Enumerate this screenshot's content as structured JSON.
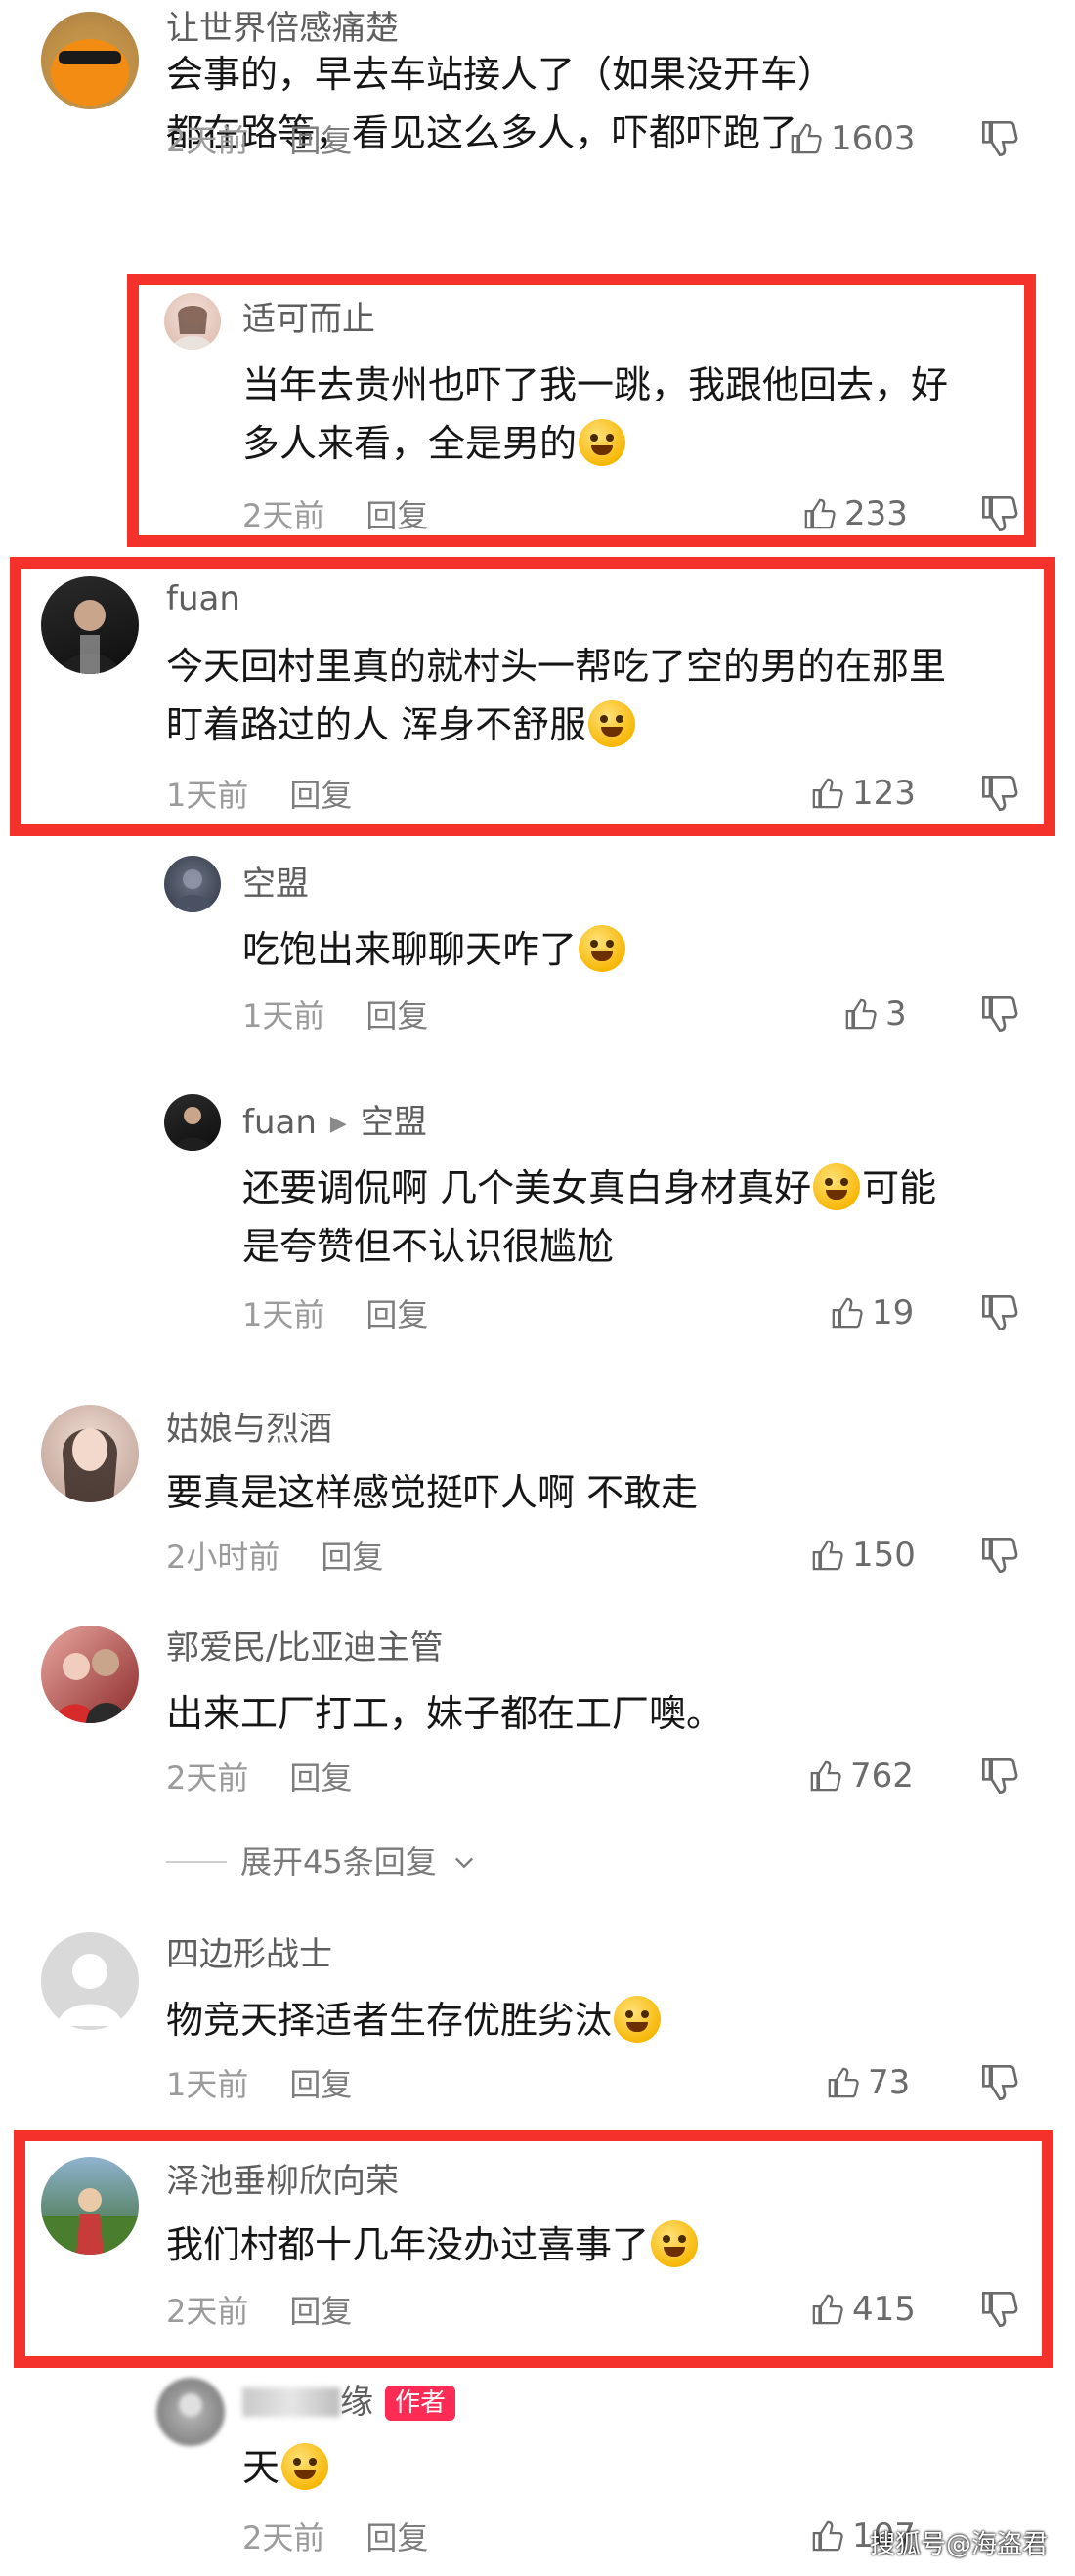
{
  "colors": {
    "highlight": "#f4322b",
    "author_badge": "#fe2c55",
    "meta": "#9b9b9b",
    "name": "#5e5e5e"
  },
  "comments": [
    {
      "user": "让世界倍感痛楚",
      "text": "会事的，早去车站接人了（如果没开车）\n都在路等，看见这么多人，吓都吓跑了",
      "time": "2天前",
      "reply": "回复",
      "likes": "1603",
      "avatar_icon": "orange-sunglasses-avatar"
    },
    {
      "user": "适可而止",
      "text": "当年去贵州也吓了我一跳，我跟他回去，好\n多人来看，全是男的",
      "time": "2天前",
      "reply": "回复",
      "likes": "233",
      "avatar_icon": "girl-avatar"
    },
    {
      "user": "fuan",
      "text": "今天回村里真的就村头一帮吃了空的男的在那里\n盯着路过的人 浑身不舒服",
      "time": "1天前",
      "reply": "回复",
      "likes": "123",
      "avatar_icon": "man-portrait-avatar"
    },
    {
      "user": "空盟",
      "text": "吃饱出来聊聊天咋了",
      "time": "1天前",
      "reply": "回复",
      "likes": "3",
      "avatar_icon": "dark-avatar"
    },
    {
      "user": "fuan",
      "reply_to": "空盟",
      "text": "还要调侃啊 几个美女真白身材真好      可能\n是夸赞但不认识很尴尬",
      "time": "1天前",
      "reply": "回复",
      "likes": "19",
      "avatar_icon": "man-portrait-avatar"
    },
    {
      "user": "姑娘与烈酒",
      "text": "要真是这样感觉挺吓人啊 不敢走",
      "time": "2小时前",
      "reply": "回复",
      "likes": "150",
      "avatar_icon": "woman-avatar"
    },
    {
      "user": "郭爱民/比亚迪主管",
      "text": "出来工厂打工，妹子都在工厂噢。",
      "time": "2天前",
      "reply": "回复",
      "likes": "762",
      "avatar_icon": "couple-avatar"
    },
    {
      "user": "四边形战士",
      "text": "物竞天择适者生存优胜劣汰",
      "time": "1天前",
      "reply": "回复",
      "likes": "73",
      "avatar_icon": "default-user-avatar"
    },
    {
      "user": "泽池垂柳欣向荣",
      "text": "我们村都十几年没办过喜事了",
      "time": "2天前",
      "reply": "回复",
      "likes": "415",
      "avatar_icon": "outdoor-avatar"
    },
    {
      "user": "缘",
      "badge": "作者",
      "text": "天",
      "time": "2天前",
      "reply": "回复",
      "likes": "107",
      "avatar_icon": "blurred-avatar"
    }
  ],
  "expand_replies": "展开45条回复",
  "watermark": "搜狐号@海盗君"
}
